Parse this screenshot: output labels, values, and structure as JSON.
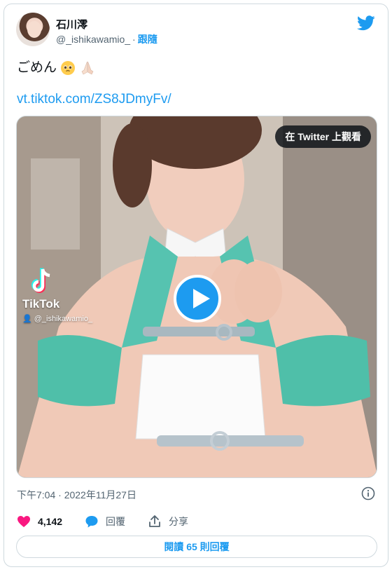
{
  "author": {
    "display_name": "石川澪",
    "handle": "@_ishikawamio_",
    "separator": "·",
    "follow_label": "跟隨"
  },
  "tweet": {
    "text": "ごめん",
    "emojis": [
      "pleading-face",
      "folded-hands"
    ],
    "link": "vt.tiktok.com/ZS8JDmyFv/"
  },
  "media": {
    "view_on_twitter": "在 Twitter 上觀看",
    "tiktok_brand": "TikTok",
    "tiktok_user": "@_ishikawamio_"
  },
  "timestamp": "下午7:04 · 2022年11月27日",
  "actions": {
    "likes": "4,142",
    "reply_label": "回覆",
    "share_label": "分享"
  },
  "read_replies": {
    "prefix": "閱讀 ",
    "count": "65",
    "suffix": " 則回覆"
  },
  "colors": {
    "accent": "#1d9bf0",
    "like": "#f91880",
    "text": "#0f1419",
    "secondary": "#536471",
    "border": "#cfd9de"
  }
}
